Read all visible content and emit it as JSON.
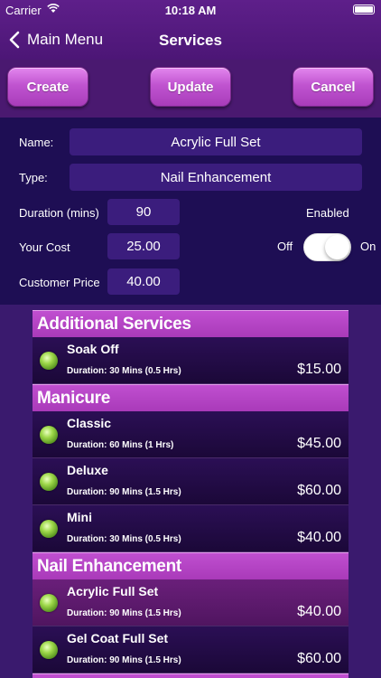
{
  "status": {
    "carrier": "Carrier",
    "time": "10:18 AM"
  },
  "nav": {
    "back_label": "Main Menu",
    "title": "Services"
  },
  "actions": {
    "create": "Create",
    "update": "Update",
    "cancel": "Cancel"
  },
  "form": {
    "name_label": "Name:",
    "name_value": "Acrylic Full Set",
    "type_label": "Type:",
    "type_value": "Nail Enhancement",
    "duration_label": "Duration (mins)",
    "duration_value": "90",
    "cost_label": "Your Cost",
    "cost_value": "25.00",
    "price_label": "Customer Price",
    "price_value": "40.00",
    "enabled_label": "Enabled",
    "off_label": "Off",
    "on_label": "On",
    "enabled": true
  },
  "sections": [
    {
      "title": "Additional Services",
      "items": [
        {
          "name": "Soak Off",
          "duration": "Duration: 30 Mins (0.5 Hrs)",
          "price": "$15.00"
        }
      ]
    },
    {
      "title": "Manicure",
      "items": [
        {
          "name": "Classic",
          "duration": "Duration: 60 Mins (1 Hrs)",
          "price": "$45.00"
        },
        {
          "name": "Deluxe",
          "duration": "Duration: 90 Mins (1.5 Hrs)",
          "price": "$60.00"
        },
        {
          "name": "Mini",
          "duration": "Duration: 30 Mins (0.5 Hrs)",
          "price": "$40.00"
        }
      ]
    },
    {
      "title": "Nail Enhancement",
      "items": [
        {
          "name": "Acrylic Full Set",
          "duration": "Duration: 90 Mins (1.5 Hrs)",
          "price": "$40.00",
          "selected": true
        },
        {
          "name": "Gel Coat Full Set",
          "duration": "Duration: 90 Mins (1.5 Hrs)",
          "price": "$60.00"
        }
      ]
    }
  ]
}
